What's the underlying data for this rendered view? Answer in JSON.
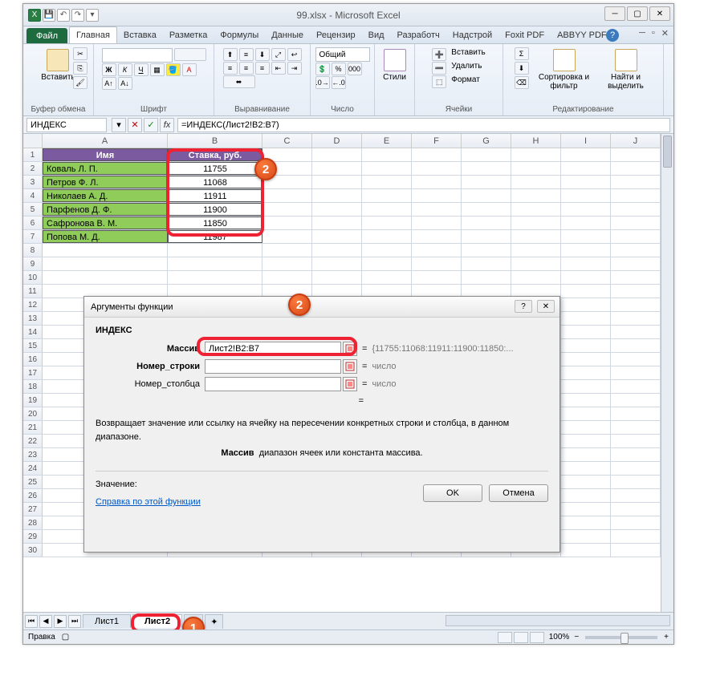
{
  "window": {
    "title": "99.xlsx - Microsoft Excel"
  },
  "tabs": {
    "file": "Файл",
    "items": [
      "Главная",
      "Вставка",
      "Разметка",
      "Формулы",
      "Данные",
      "Рецензир",
      "Вид",
      "Разработч",
      "Надстрой",
      "Foxit PDF",
      "ABBYY PDF"
    ],
    "active": 0
  },
  "ribbon": {
    "clipboard": {
      "paste": "Вставить",
      "label": "Буфер обмена"
    },
    "font": {
      "name": "",
      "size": "",
      "label": "Шрифт"
    },
    "align": {
      "label": "Выравнивание"
    },
    "number": {
      "format": "Общий",
      "label": "Число"
    },
    "styles": {
      "btn": "Стили",
      "label": ""
    },
    "cells": {
      "insert": "Вставить",
      "delete": "Удалить",
      "format": "Формат",
      "label": "Ячейки"
    },
    "editing": {
      "sort": "Сортировка и фильтр",
      "find": "Найти и выделить",
      "label": "Редактирование"
    }
  },
  "formulabar": {
    "name": "ИНДЕКС",
    "formula": "=ИНДЕКС(Лист2!B2:B7)"
  },
  "columns": [
    "A",
    "B",
    "C",
    "D",
    "E",
    "F",
    "G",
    "H",
    "I",
    "J"
  ],
  "headers": {
    "a": "Имя",
    "b": "Ставка, руб."
  },
  "data": [
    {
      "name": "Коваль Л. П.",
      "val": "11755"
    },
    {
      "name": "Петров Ф. Л.",
      "val": "11068"
    },
    {
      "name": "Николаев А. Д.",
      "val": "11911"
    },
    {
      "name": "Парфенов Д. Ф.",
      "val": "11900"
    },
    {
      "name": "Сафронова В. М.",
      "val": "11850"
    },
    {
      "name": "Попова М. Д.",
      "val": "11987"
    }
  ],
  "dialog": {
    "title": "Аргументы функции",
    "fn": "ИНДЕКС",
    "args": {
      "array_label": "Массив",
      "array_value": "Лист2!B2:B7",
      "array_result": "{11755:11068:11911:11900:11850:...",
      "row_label": "Номер_строки",
      "row_result": "число",
      "col_label": "Номер_столбца",
      "col_result": "число"
    },
    "eq_label": "=",
    "desc1": "Возвращает значение или ссылку на ячейку на пересечении конкретных строки и столбца, в данном диапазоне.",
    "desc2_label": "Массив",
    "desc2_text": "диапазон ячеек или константа массива.",
    "value_label": "Значение:",
    "help": "Справка по этой функции",
    "ok": "OK",
    "cancel": "Отмена"
  },
  "sheets": {
    "s1": "Лист1",
    "s2": "Лист2",
    "s3": "3"
  },
  "status": {
    "mode": "Правка",
    "zoom": "100%"
  },
  "badges": {
    "b1": "1",
    "b2": "2",
    "b2b": "2"
  }
}
